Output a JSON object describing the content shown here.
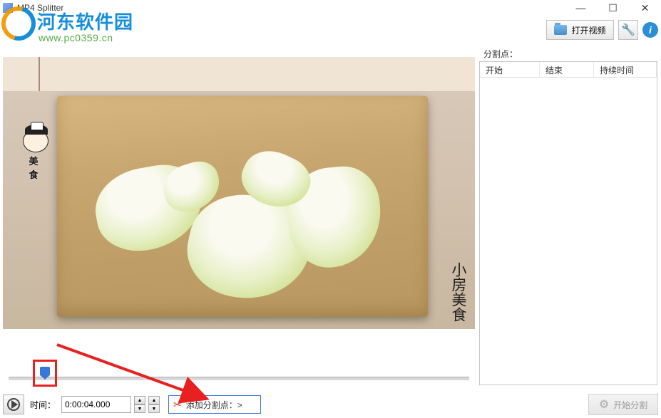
{
  "window": {
    "title": "MP4 Splitter",
    "minimize": "—",
    "maximize": "☐",
    "close": "✕"
  },
  "watermark": {
    "text": "河东软件园",
    "url": "www.pc0359.cn"
  },
  "toolbar": {
    "open_video": "打开视频",
    "split_points_label": "分割点："
  },
  "list": {
    "col_start": "开始",
    "col_end": "结束",
    "col_duration": "持续时间"
  },
  "video": {
    "avatar_label": "美 食",
    "corner_label": "小房美食"
  },
  "controls": {
    "time_label": "时间：",
    "time_value": "0:00:04.000",
    "add_split": "添加分割点：>",
    "start_split": "开始分割"
  }
}
